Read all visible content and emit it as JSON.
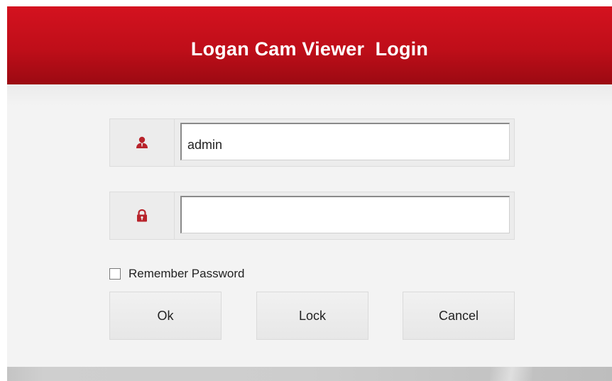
{
  "window": {
    "title": "Logan Cam Viewer  Login"
  },
  "username": {
    "icon": "user-icon",
    "value": "admin",
    "placeholder": ""
  },
  "password": {
    "icon": "lock-icon",
    "value": "",
    "placeholder": ""
  },
  "remember": {
    "label": "Remember Password",
    "checked": false
  },
  "buttons": {
    "ok": "Ok",
    "lock": "Lock",
    "cancel": "Cancel"
  },
  "colors": {
    "accent": "#c0101a",
    "icon": "#b8232b"
  }
}
